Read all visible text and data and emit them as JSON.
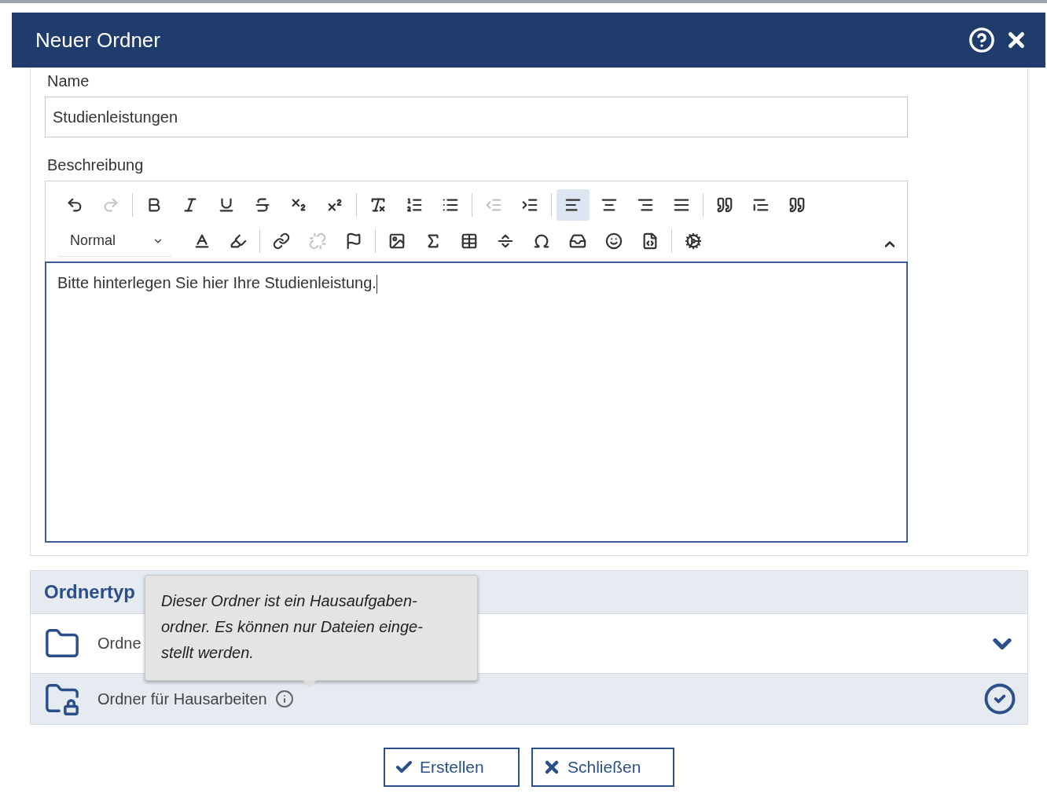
{
  "dialog": {
    "title": "Neuer Ordner"
  },
  "name_field": {
    "label": "Name",
    "value": "Studienleistungen"
  },
  "description": {
    "label": "Beschreibung",
    "toolbar_rows": [
      [
        {
          "kind": "undo",
          "disabled": false
        },
        {
          "kind": "redo",
          "disabled": true
        },
        {
          "kind": "separator"
        },
        {
          "kind": "bold",
          "disabled": false
        },
        {
          "kind": "italic",
          "disabled": false
        },
        {
          "kind": "underline",
          "disabled": false
        },
        {
          "kind": "strike",
          "disabled": false
        },
        {
          "kind": "subscript",
          "disabled": false
        },
        {
          "kind": "superscript",
          "disabled": false
        },
        {
          "kind": "separator"
        },
        {
          "kind": "clear-format",
          "disabled": false
        },
        {
          "kind": "numbered-list",
          "disabled": false
        },
        {
          "kind": "bullet-list",
          "disabled": false
        },
        {
          "kind": "separator"
        },
        {
          "kind": "outdent",
          "disabled": true
        },
        {
          "kind": "indent",
          "disabled": false
        },
        {
          "kind": "separator"
        },
        {
          "kind": "align-left",
          "disabled": false,
          "active": true
        },
        {
          "kind": "align-center",
          "disabled": false,
          "active": false
        },
        {
          "kind": "align-right",
          "disabled": false,
          "active": false
        },
        {
          "kind": "align-justify",
          "disabled": false,
          "active": false
        },
        {
          "kind": "separator"
        },
        {
          "kind": "blockquote",
          "disabled": false
        },
        {
          "kind": "div",
          "disabled": false
        },
        {
          "kind": "remove-quote",
          "disabled": false
        }
      ],
      [
        {
          "kind": "format-select",
          "label": "Normal"
        },
        {
          "kind": "text-color",
          "disabled": false
        },
        {
          "kind": "bg-color",
          "disabled": false
        },
        {
          "kind": "separator"
        },
        {
          "kind": "link",
          "disabled": false
        },
        {
          "kind": "unlink",
          "disabled": true
        },
        {
          "kind": "anchor",
          "disabled": false
        },
        {
          "kind": "separator"
        },
        {
          "kind": "image",
          "disabled": false
        },
        {
          "kind": "formula",
          "disabled": false
        },
        {
          "kind": "table",
          "disabled": false
        },
        {
          "kind": "hr",
          "disabled": false
        },
        {
          "kind": "special-char",
          "disabled": false
        },
        {
          "kind": "page-break",
          "disabled": false
        },
        {
          "kind": "smiley",
          "disabled": false
        },
        {
          "kind": "source",
          "disabled": false
        },
        {
          "kind": "separator"
        },
        {
          "kind": "settings",
          "disabled": false
        }
      ]
    ],
    "collapsed": false,
    "content": "Bitte hinterlegen Sie hier Ihre Studienleistung."
  },
  "folder_type": {
    "title": "Ordnertyp",
    "options": [
      {
        "kind": "plain",
        "label": "Ordne",
        "selected": false,
        "info": false
      },
      {
        "kind": "locked",
        "label": "Ordner für Hausarbeiten",
        "selected": true,
        "info": true
      }
    ],
    "tooltip": {
      "lines": [
        "Dieser Ordner ist ein Hausaufgaben-",
        "ordner. Es können nur Dateien einge-",
        "stellt werden."
      ]
    }
  },
  "buttons": [
    {
      "kind": "confirm",
      "label": "Erstellen"
    },
    {
      "kind": "close",
      "label": "Schließen"
    }
  ]
}
